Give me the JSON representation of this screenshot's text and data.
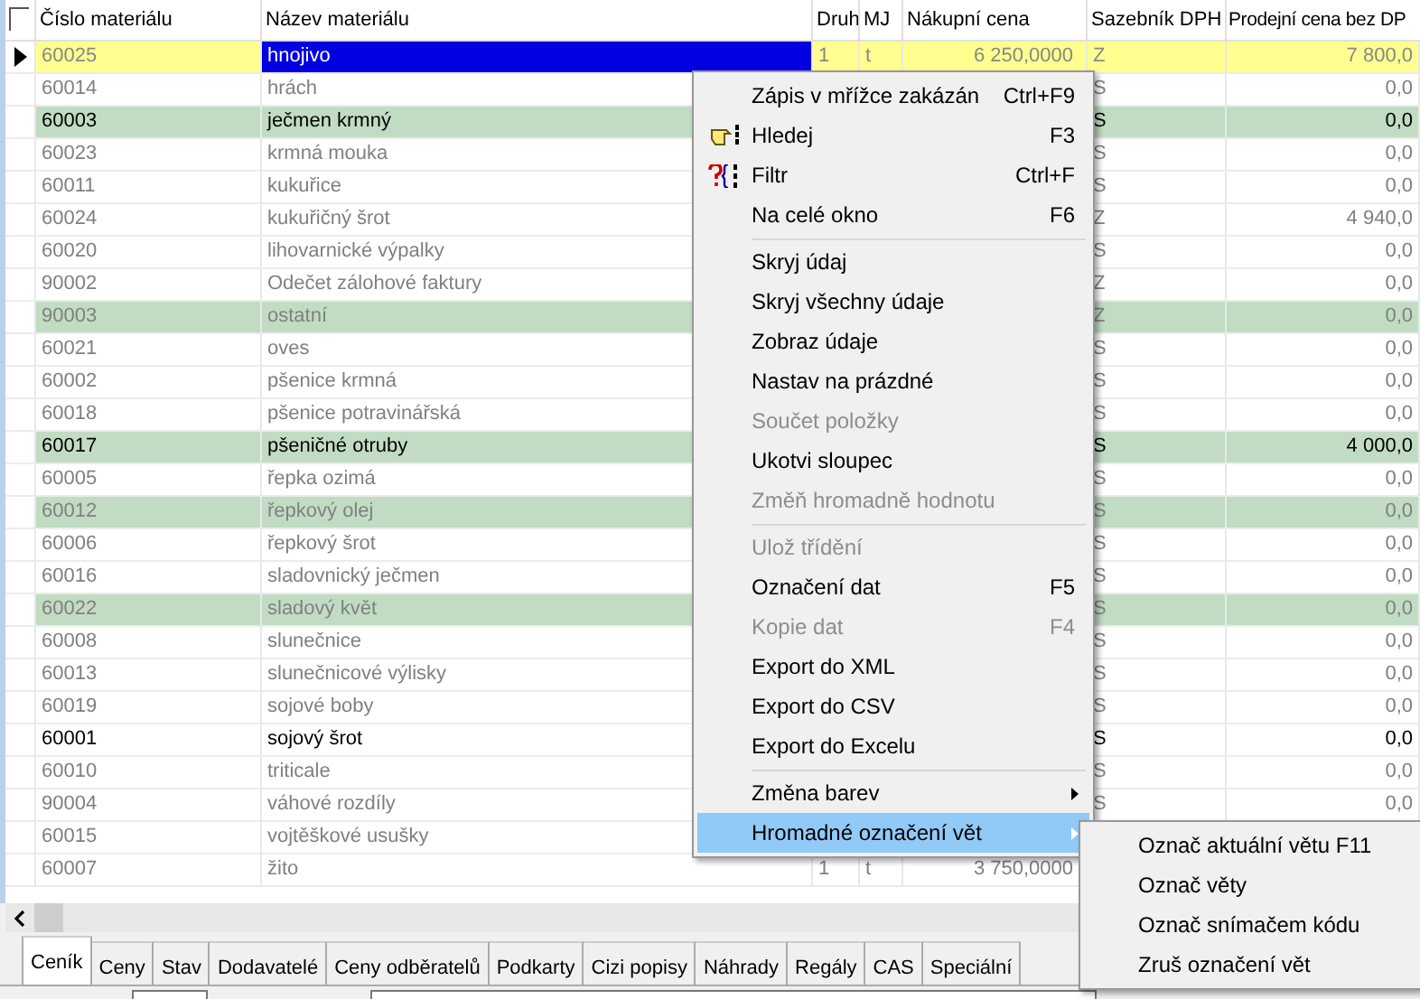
{
  "table": {
    "select_all": {
      "checked": false
    },
    "columns": [
      "Číslo materiálu",
      "Název materiálu",
      "Druh",
      "MJ",
      "Nákupní cena",
      "Sazebník DPH",
      "Prodejní cena bez DP"
    ],
    "rows": [
      {
        "cislo": "60025",
        "nazev": "hnojivo",
        "druh": "1",
        "mj": "t",
        "nakupni": "6 250,0000",
        "sazebnik": "Z",
        "prodejni": "7 800,0",
        "selected": true,
        "marked": false,
        "emphasized": false
      },
      {
        "cislo": "60014",
        "nazev": "hrách",
        "sazebnik": "S",
        "prodejni": "0,0",
        "selected": false,
        "marked": false,
        "emphasized": false
      },
      {
        "cislo": "60003",
        "nazev": "ječmen krmný",
        "sazebnik": "S",
        "prodejni": "0,0",
        "selected": false,
        "marked": true,
        "emphasized": true
      },
      {
        "cislo": "60023",
        "nazev": "krmná mouka",
        "sazebnik": "S",
        "prodejni": "0,0",
        "selected": false,
        "marked": false,
        "emphasized": false
      },
      {
        "cislo": "60011",
        "nazev": "kukuřice",
        "sazebnik": "S",
        "prodejni": "0,0",
        "selected": false,
        "marked": false,
        "emphasized": false
      },
      {
        "cislo": "60024",
        "nazev": "kukuřičný šrot",
        "sazebnik": "Z",
        "prodejni": "4 940,0",
        "selected": false,
        "marked": false,
        "emphasized": false
      },
      {
        "cislo": "60020",
        "nazev": "lihovarnické výpalky",
        "sazebnik": "S",
        "prodejni": "0,0",
        "selected": false,
        "marked": false,
        "emphasized": false
      },
      {
        "cislo": "90002",
        "nazev": "Odečet zálohové faktury",
        "sazebnik": "Z",
        "prodejni": "0,0",
        "selected": false,
        "marked": false,
        "emphasized": false
      },
      {
        "cislo": "90003",
        "nazev": "ostatní",
        "sazebnik": "Z",
        "prodejni": "0,0",
        "selected": false,
        "marked": true,
        "emphasized": false
      },
      {
        "cislo": "60021",
        "nazev": "oves",
        "sazebnik": "S",
        "prodejni": "0,0",
        "selected": false,
        "marked": false,
        "emphasized": false
      },
      {
        "cislo": "60002",
        "nazev": "pšenice krmná",
        "sazebnik": "S",
        "prodejni": "0,0",
        "selected": false,
        "marked": false,
        "emphasized": false
      },
      {
        "cislo": "60018",
        "nazev": "pšenice potravinářská",
        "sazebnik": "S",
        "prodejni": "0,0",
        "selected": false,
        "marked": false,
        "emphasized": false
      },
      {
        "cislo": "60017",
        "nazev": "pšeničné otruby",
        "sazebnik": "S",
        "prodejni": "4 000,0",
        "selected": false,
        "marked": true,
        "emphasized": true
      },
      {
        "cislo": "60005",
        "nazev": "řepka ozimá",
        "sazebnik": "S",
        "prodejni": "0,0",
        "selected": false,
        "marked": false,
        "emphasized": false
      },
      {
        "cislo": "60012",
        "nazev": "řepkový olej",
        "sazebnik": "S",
        "prodejni": "0,0",
        "selected": false,
        "marked": true,
        "emphasized": false
      },
      {
        "cislo": "60006",
        "nazev": "řepkový šrot",
        "sazebnik": "S",
        "prodejni": "0,0",
        "selected": false,
        "marked": false,
        "emphasized": false
      },
      {
        "cislo": "60016",
        "nazev": "sladovnický ječmen",
        "sazebnik": "S",
        "prodejni": "0,0",
        "selected": false,
        "marked": false,
        "emphasized": false
      },
      {
        "cislo": "60022",
        "nazev": "sladový květ",
        "sazebnik": "S",
        "prodejni": "0,0",
        "selected": false,
        "marked": true,
        "emphasized": false
      },
      {
        "cislo": "60008",
        "nazev": "slunečnice",
        "sazebnik": "S",
        "prodejni": "0,0",
        "selected": false,
        "marked": false,
        "emphasized": false
      },
      {
        "cislo": "60013",
        "nazev": "slunečnicové výlisky",
        "sazebnik": "S",
        "prodejni": "0,0",
        "selected": false,
        "marked": false,
        "emphasized": false
      },
      {
        "cislo": "60019",
        "nazev": "sojové boby",
        "sazebnik": "S",
        "prodejni": "0,0",
        "selected": false,
        "marked": false,
        "emphasized": false
      },
      {
        "cislo": "60001",
        "nazev": "sojový šrot",
        "sazebnik": "S",
        "prodejni": "0,0",
        "selected": false,
        "marked": false,
        "emphasized": true
      },
      {
        "cislo": "60010",
        "nazev": "triticale",
        "sazebnik": "S",
        "prodejni": "0,0",
        "selected": false,
        "marked": false,
        "emphasized": false
      },
      {
        "cislo": "90004",
        "nazev": "váhové rozdíly",
        "sazebnik": "S",
        "prodejni": "0,0",
        "selected": false,
        "marked": false,
        "emphasized": false
      },
      {
        "cislo": "60015",
        "nazev": "vojtěškové usušky",
        "selected": false,
        "marked": false,
        "emphasized": false
      },
      {
        "cislo": "60007",
        "nazev": "žito",
        "druh": "1",
        "mj": "t",
        "nakupni": "3 750,0000",
        "selected": false,
        "marked": false,
        "emphasized": false
      }
    ]
  },
  "tabs": [
    {
      "label": "Ceník",
      "selected": true
    },
    {
      "label": "Ceny",
      "selected": false
    },
    {
      "label": "Stav",
      "selected": false
    },
    {
      "label": "Dodavatelé",
      "selected": false
    },
    {
      "label": "Ceny odběratelů",
      "selected": false
    },
    {
      "label": "Podkarty",
      "selected": false
    },
    {
      "label": "Cizi popisy",
      "selected": false
    },
    {
      "label": "Náhrady",
      "selected": false
    },
    {
      "label": "Regály",
      "selected": false
    },
    {
      "label": "CAS",
      "selected": false
    },
    {
      "label": "Speciální",
      "selected": false
    }
  ],
  "context_menu": {
    "items": [
      {
        "kind": "item",
        "label": "Zápis v mřížce zakázán",
        "shortcut": "Ctrl+F9",
        "disabled": false,
        "selected": false
      },
      {
        "kind": "search",
        "label": "Hledej",
        "shortcut": "F3",
        "disabled": false,
        "selected": false
      },
      {
        "kind": "filter",
        "label": "Filtr",
        "shortcut": "Ctrl+F",
        "disabled": false,
        "selected": false
      },
      {
        "kind": "item",
        "label": "Na celé okno",
        "shortcut": "F6",
        "disabled": false,
        "selected": false
      },
      {
        "kind": "separator"
      },
      {
        "kind": "item",
        "label": "Skryj údaj",
        "disabled": false,
        "selected": false
      },
      {
        "kind": "item",
        "label": "Skryj všechny údaje",
        "disabled": false,
        "selected": false
      },
      {
        "kind": "item",
        "label": "Zobraz údaje",
        "disabled": false,
        "selected": false
      },
      {
        "kind": "item",
        "label": "Nastav na prázdné",
        "disabled": false,
        "selected": false
      },
      {
        "kind": "item",
        "label": "Součet položky",
        "disabled": true,
        "selected": false
      },
      {
        "kind": "item",
        "label": "Ukotvi sloupec",
        "disabled": false,
        "selected": false
      },
      {
        "kind": "item",
        "label": "Změň hromadně hodnotu",
        "disabled": true,
        "selected": false
      },
      {
        "kind": "separator"
      },
      {
        "kind": "item",
        "label": "Ulož třídění",
        "disabled": true,
        "selected": false
      },
      {
        "kind": "item",
        "label": "Označení dat",
        "shortcut": "F5",
        "disabled": false,
        "selected": false
      },
      {
        "kind": "item",
        "label": "Kopie dat",
        "shortcut": "F4",
        "disabled": true,
        "selected": false
      },
      {
        "kind": "item",
        "label": "Export do XML",
        "disabled": false,
        "selected": false
      },
      {
        "kind": "item",
        "label": "Export do CSV",
        "disabled": false,
        "selected": false
      },
      {
        "kind": "item",
        "label": "Export do Excelu",
        "disabled": false,
        "selected": false
      },
      {
        "kind": "separator"
      },
      {
        "kind": "item",
        "label": "Změna barev",
        "submenu": true,
        "disabled": false,
        "selected": false
      },
      {
        "kind": "item",
        "label": "Hromadné označení vět",
        "submenu": true,
        "disabled": false,
        "selected": true
      }
    ]
  },
  "submenu": {
    "items": [
      {
        "label": "Označ aktuální větu F11"
      },
      {
        "label": "Označ věty"
      },
      {
        "label": "Označ snímačem kódu"
      },
      {
        "label": "Zruš označení vět"
      }
    ]
  }
}
